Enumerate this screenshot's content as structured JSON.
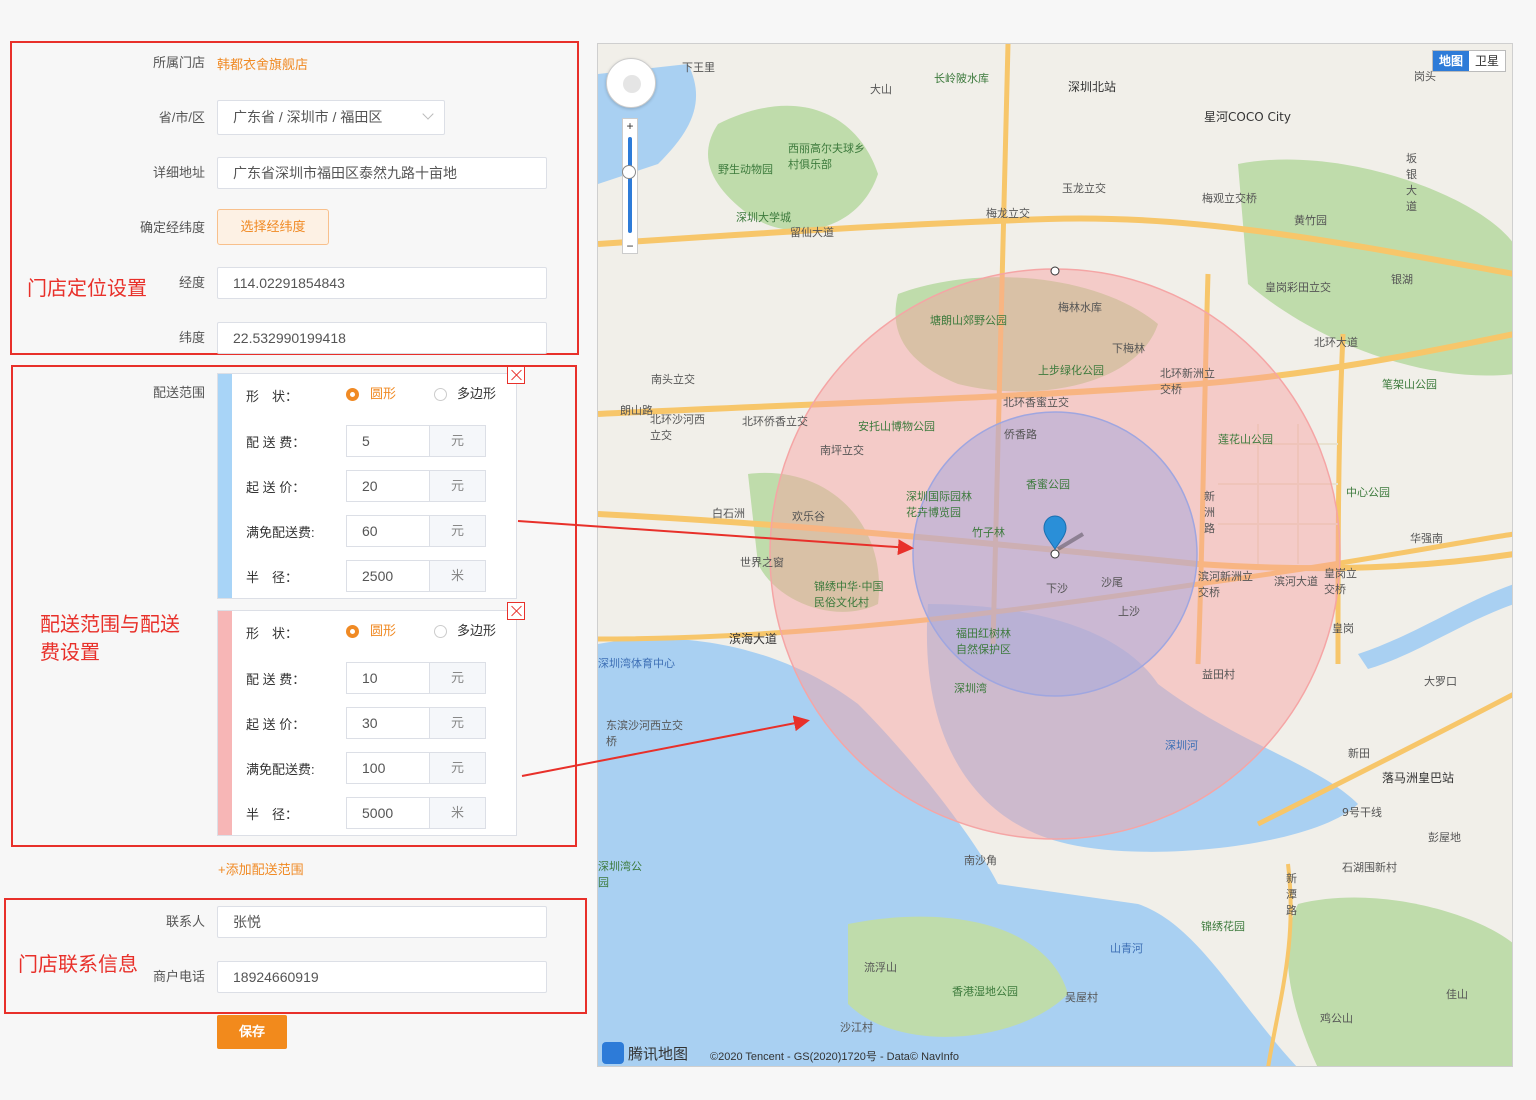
{
  "annotations": {
    "location_title": "门店定位设置",
    "delivery_title_line1": "配送范围与配送",
    "delivery_title_line2": "费设置",
    "contact_title": "门店联系信息"
  },
  "store": {
    "store_label": "所属门店",
    "store_value": "韩都衣舍旗舰店",
    "region_label": "省/市/区",
    "region_value": "广东省 / 深圳市 / 福田区",
    "address_label": "详细地址",
    "address_value": "广东省深圳市福田区泰然九路十亩地",
    "latlng_label": "确定经纬度",
    "latlng_button": "选择经纬度",
    "lng_label": "经度",
    "lng_value": "114.02291854843",
    "lat_label": "纬度",
    "lat_value": "22.532990199418"
  },
  "delivery": {
    "range_label": "配送范围",
    "shape_label": "形　状：",
    "fee_label": "配 送 费：",
    "min_label": "起 送 价：",
    "free_label": "满免配送费:",
    "radius_label": "半　径：",
    "circle_option": "圆形",
    "polygon_option": "多边形",
    "zones": [
      {
        "fee": "5",
        "fee_unit": "元",
        "min": "20",
        "min_unit": "元",
        "free": "60",
        "free_unit": "元",
        "radius": "2500",
        "radius_unit": "米",
        "color": "#a8d4f7"
      },
      {
        "fee": "10",
        "fee_unit": "元",
        "min": "30",
        "min_unit": "元",
        "free": "100",
        "free_unit": "元",
        "radius": "5000",
        "radius_unit": "米",
        "color": "#f7b6b6"
      }
    ],
    "add_range": "+添加配送范围"
  },
  "contact": {
    "person_label": "联系人",
    "person_value": "张悦",
    "phone_label": "商户电话",
    "phone_value": "18924660919"
  },
  "save_button": "保存",
  "map": {
    "type_map": "地图",
    "type_satellite": "卫星",
    "logo_text": "腾讯地图",
    "copyright": "©2020 Tencent - GS(2020)1720号 - Data© NavInfo",
    "labels": [
      "深圳北站",
      "星河COCO City",
      "长岭陂水库",
      "大山",
      "下王里",
      "西丽高尔夫球乡村俱乐部",
      "野生动物园",
      "深圳大学城",
      "留仙大道",
      "梅观立交桥",
      "玉龙立交",
      "梅龙立交",
      "塘朗山郊野公园",
      "梅林水库",
      "上步绿化公园",
      "下梅林",
      "北环新洲立交桥",
      "北环大道",
      "笔架山公园",
      "南头立交",
      "朗山路",
      "北环沙河西立交",
      "北环侨香立交",
      "安托山博物公园",
      "南坪立交",
      "北环香蜜立交",
      "侨香路",
      "香蜜公园",
      "莲花山公园",
      "中心公园",
      "白石洲",
      "欢乐谷",
      "世界之窗",
      "深圳国际园林花卉博览园",
      "锦绣中华·中国民俗文化村",
      "竹子林",
      "新洲路",
      "滨河新洲立交桥",
      "滨河大道",
      "皇岗立交桥",
      "华强南",
      "滨海大道",
      "深圳湾体育中心",
      "福田红树林自然保护区",
      "深圳湾",
      "益田村",
      "沙尾",
      "上沙",
      "下沙",
      "皇岗",
      "大罗口",
      "东滨沙河西立交桥",
      "深圳河",
      "新田",
      "落马洲皇巴站",
      "南沙角",
      "流浮山",
      "香港湿地公园",
      "山青河",
      "锦绣花园",
      "吴屋村",
      "沙江村",
      "新潭路",
      "9号干线",
      "深圳湾公园",
      "石湖围新村",
      "彭屋地",
      "佳山",
      "鸡公山",
      "银湖",
      "黄竹园",
      "岗头",
      "坂银大道",
      "皇岗彩田立交"
    ]
  }
}
